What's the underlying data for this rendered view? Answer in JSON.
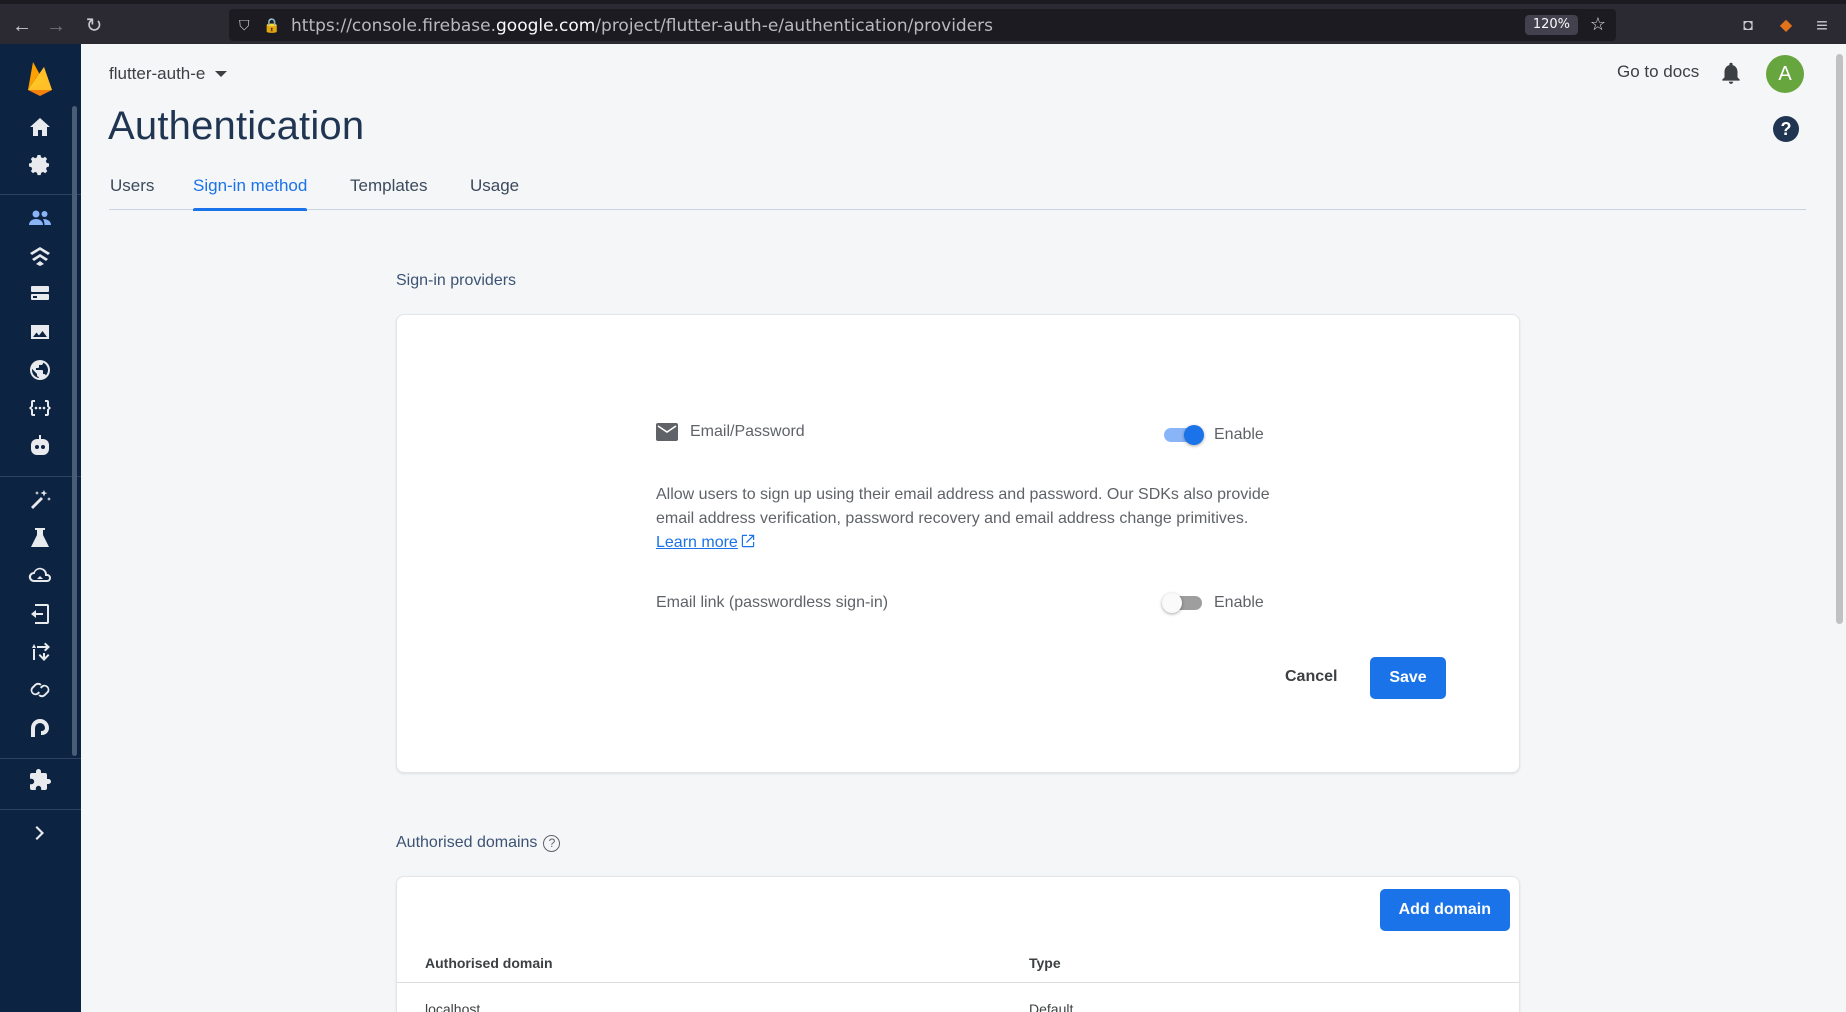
{
  "browser": {
    "url_prefix": "https://console.firebase.",
    "url_domain": "google.com",
    "url_suffix": "/project/flutter-auth-e/authentication/providers",
    "zoom": "120%"
  },
  "header": {
    "project_name": "flutter-auth-e",
    "go_to_docs": "Go to docs",
    "avatar_letter": "A",
    "page_title": "Authentication",
    "help_icon_glyph": "?"
  },
  "tabs": [
    {
      "label": "Users",
      "active": false
    },
    {
      "label": "Sign-in method",
      "active": true
    },
    {
      "label": "Templates",
      "active": false
    },
    {
      "label": "Usage",
      "active": false
    }
  ],
  "sign_in_providers": {
    "section_title": "Sign-in providers",
    "email_password": {
      "label": "Email/Password",
      "enabled": true,
      "toggle_label": "Enable",
      "description": "Allow users to sign up using their email address and password. Our SDKs also provide email address verification, password recovery and email address change primitives.",
      "learn_more": "Learn more"
    },
    "email_link": {
      "label": "Email link (passwordless sign-in)",
      "enabled": false,
      "toggle_label": "Enable"
    },
    "cancel_label": "Cancel",
    "save_label": "Save"
  },
  "authorised_domains": {
    "section_title": "Authorised domains",
    "add_domain_label": "Add domain",
    "columns": [
      "Authorised domain",
      "Type"
    ],
    "rows": [
      {
        "domain": "localhost",
        "type": "Default"
      }
    ]
  },
  "sidebar": {
    "icons": [
      "firebase-logo",
      "home-icon",
      "settings-icon",
      "authentication-icon",
      "firestore-icon",
      "realtime-database-icon",
      "storage-icon",
      "hosting-icon",
      "functions-icon",
      "machine-learning-icon",
      "crashlytics-icon",
      "test-lab-icon",
      "app-distribution-icon",
      "remote-config-icon",
      "ab-testing-icon",
      "dynamic-links-icon",
      "analytics-icon",
      "extensions-icon",
      "expand-icon"
    ]
  },
  "colors": {
    "primary": "#1a73e8",
    "sidebar_bg": "#0d2342",
    "title_color": "#1f3552",
    "avatar_bg": "#67a53f"
  }
}
